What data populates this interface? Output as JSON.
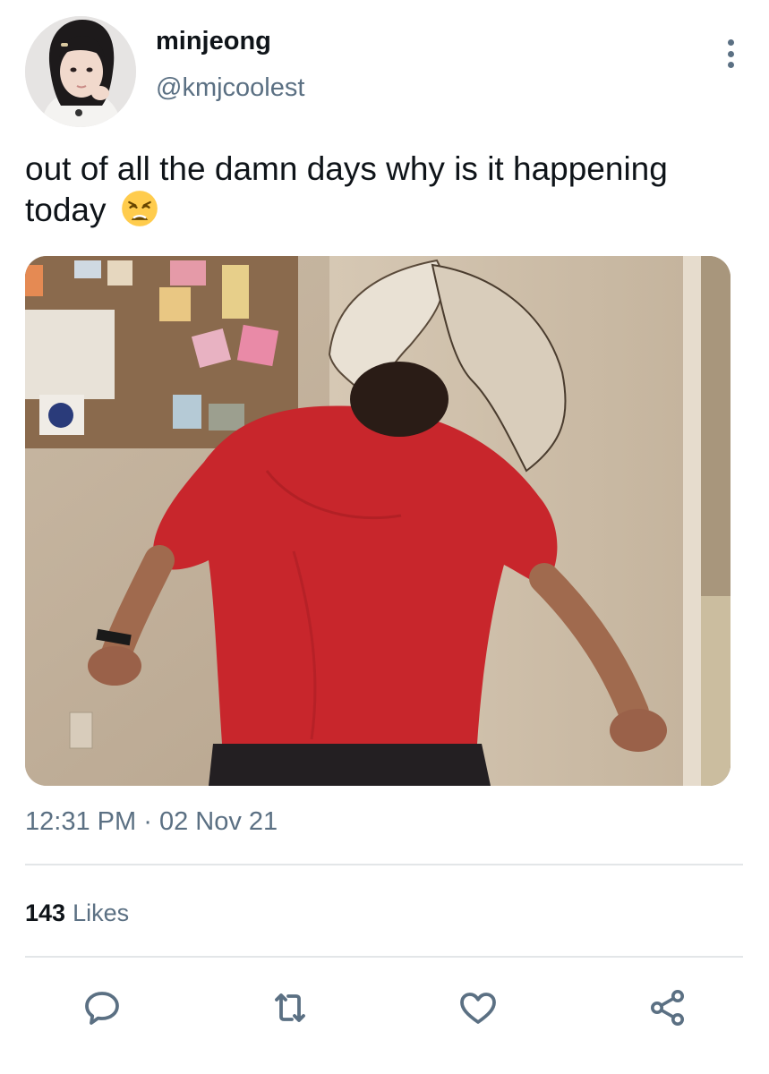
{
  "author": {
    "display_name": "minjeong",
    "handle": "@kmjcoolest",
    "avatar_icon": "profile-photo"
  },
  "tweet": {
    "text": "out of all the damn days why is it happening today",
    "emoji": "weary-face",
    "media_icon": "photo-person-wall-hole"
  },
  "meta": {
    "time": "12:31 PM",
    "separator": "·",
    "date": "02 Nov 21"
  },
  "stats": {
    "likes_count": "143",
    "likes_label": "Likes"
  },
  "actions": {
    "reply_icon": "reply-icon",
    "retweet_icon": "retweet-icon",
    "like_icon": "heart-icon",
    "share_icon": "share-icon"
  },
  "colors": {
    "text": "#0f1419",
    "secondary": "#5b7083",
    "divider": "#e3e6e8"
  }
}
